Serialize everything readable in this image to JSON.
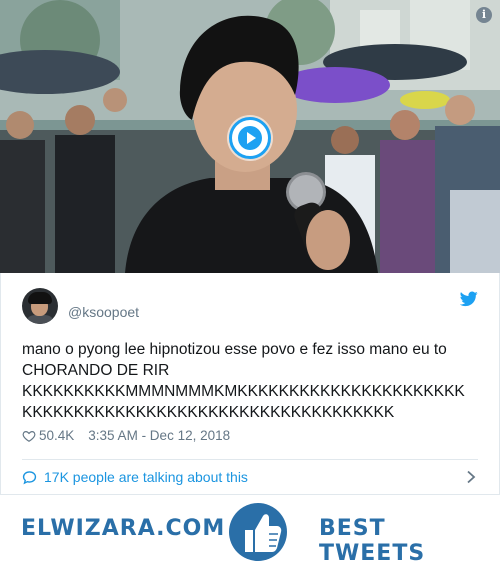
{
  "media": {
    "play_icon": "play-icon",
    "info_icon": "info-icon",
    "info_glyph": "i"
  },
  "tweet": {
    "handle": "@ksoopoet",
    "text_line1": "mano o pyong lee hipnotizou esse povo e fez isso mano eu to",
    "text_line2": "CHORANDO DE RIR",
    "text_line3": "KKKKKKKKKKMMMNMMMKMKKKKKKKKKKKKKKKKKKKKKK",
    "text_line4": "KKKKKKKKKKKKKKKKKKKKKKKKKKKKKKKKKKKK",
    "likes": "50.4K",
    "timestamp": "3:35 AM - Dec 12, 2018",
    "conversation": "17K people are talking about this",
    "brand_icon": "twitter-bird-icon",
    "colors": {
      "accent": "#1da1f2",
      "link": "#1b95e0",
      "muted": "#657786"
    }
  },
  "banner": {
    "brand": "ELWIZARA.COM",
    "tagline": "BEST TWEETS",
    "icon": "thumbs-up-icon",
    "color": "#2a6fa8"
  }
}
